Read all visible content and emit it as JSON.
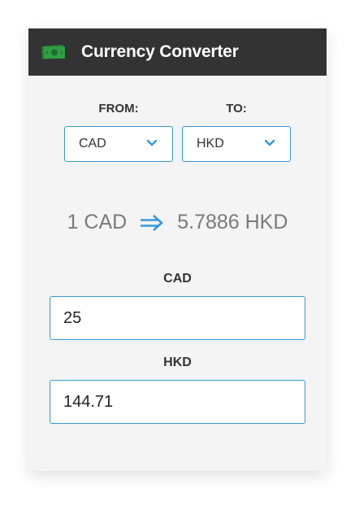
{
  "header": {
    "icon": "money-bill-icon",
    "title": "Currency Converter"
  },
  "from": {
    "label": "FROM:",
    "selected": "CAD"
  },
  "to": {
    "label": "TO:",
    "selected": "HKD"
  },
  "rate": {
    "base": "1 CAD",
    "arrow_icon": "double-arrow-right-icon",
    "result": "5.7886 HKD"
  },
  "amount_from": {
    "label": "CAD",
    "value": "25"
  },
  "amount_to": {
    "label": "HKD",
    "value": "144.71"
  },
  "colors": {
    "header_bg": "#333333",
    "accent": "#3498db",
    "icon_green": "#2e7d32",
    "card_bg": "#f4f4f4"
  }
}
